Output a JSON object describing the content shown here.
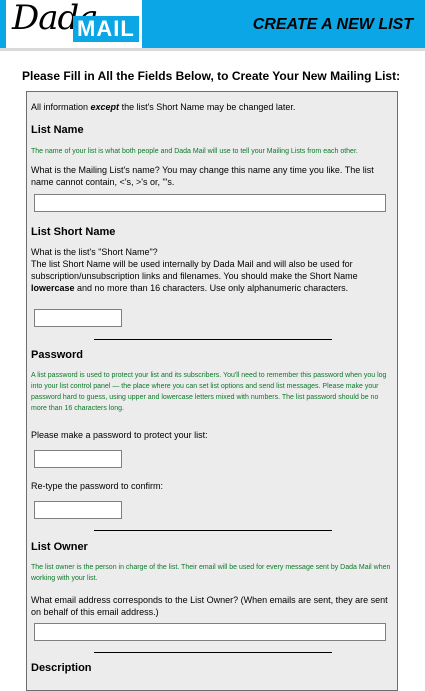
{
  "header": {
    "logo_dada": "Dada",
    "logo_mail": "MAIL",
    "title": "CREATE A NEW LIST"
  },
  "intro": "Please Fill in All the Fields Below, to Create Your New Mailing List:",
  "notice": {
    "prefix": "All information ",
    "emphasis": "except",
    "suffix": " the list's Short Name may be changed later."
  },
  "list_name": {
    "heading": "List Name",
    "help": "The name of your list is what both people and Dada Mail will use to tell your Mailing Lists from each other.",
    "question": "What is the Mailing List's name? You may change this name any time you like. The list name cannot contain, <'s, >'s or, \"'s.",
    "value": ""
  },
  "list_short_name": {
    "heading": "List Short Name",
    "question_line1": "What is the list's \"Short Name\"?",
    "question_line2_prefix": "The list Short Name will be used internally by Dada Mail and will also be used for subscription/unsubscription links and filenames. You should make the Short Name ",
    "question_line2_bold": "lowercase",
    "question_line2_suffix": " and no more than 16 characters. Use only alphanumeric characters.",
    "value": ""
  },
  "password": {
    "heading": "Password",
    "help": "A list password is used to protect your list and its subscribers. You'll need to remember this password when you log into your list control panel — the place where you can set list options and send list messages. Please make your password hard to guess, using upper and lowercase letters mixed with numbers. The list password should be no more than 16 characters long.",
    "prompt": "Please make a password to protect your list:",
    "confirm_prompt": "Re-type the password to confirm:",
    "value": "",
    "confirm_value": ""
  },
  "list_owner": {
    "heading": "List Owner",
    "help": "The list owner is the person in charge of the list. Their email will be used for every message sent by Dada Mail when working with your list.",
    "question": "What email address corresponds to the List Owner? (When emails are sent, they are sent on behalf of this email address.)",
    "value": ""
  },
  "description": {
    "heading": "Description"
  }
}
